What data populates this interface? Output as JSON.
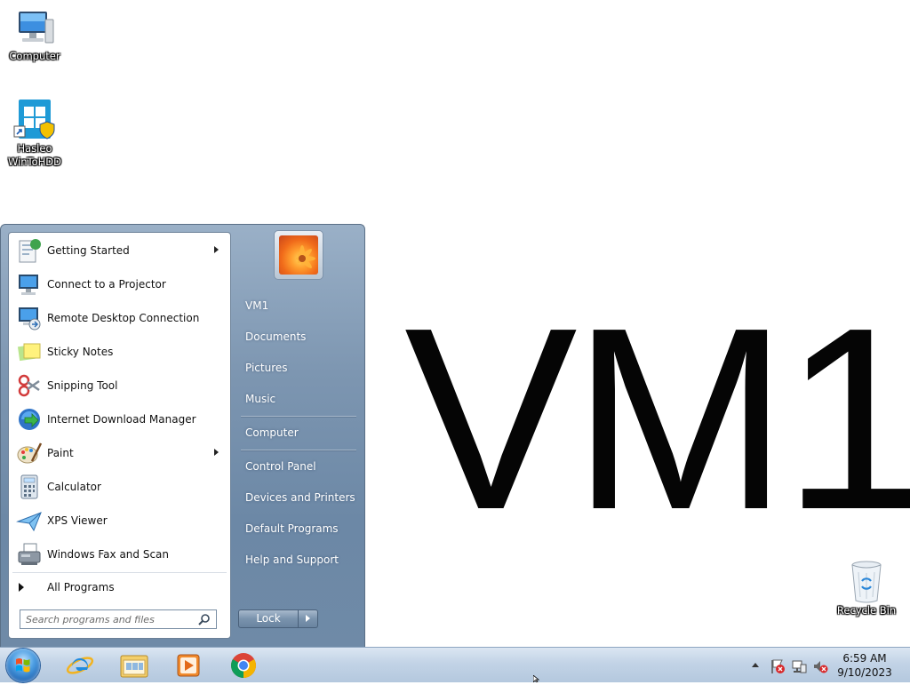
{
  "desktop": {
    "wallpaper_text": "VM1",
    "icons": [
      {
        "label": "Computer"
      },
      {
        "label": "Hasleo WinToHDD"
      },
      {
        "label": "Recycle Bin"
      }
    ]
  },
  "start_menu": {
    "programs": [
      {
        "label": "Getting Started",
        "icon": "getting-started-icon",
        "submenu": true
      },
      {
        "label": "Connect to a Projector",
        "icon": "projector-icon",
        "submenu": false
      },
      {
        "label": "Remote Desktop Connection",
        "icon": "remote-desktop-icon",
        "submenu": false
      },
      {
        "label": "Sticky Notes",
        "icon": "sticky-notes-icon",
        "submenu": false
      },
      {
        "label": "Snipping Tool",
        "icon": "snipping-tool-icon",
        "submenu": false
      },
      {
        "label": "Internet Download Manager",
        "icon": "idm-icon",
        "submenu": false
      },
      {
        "label": "Paint",
        "icon": "paint-icon",
        "submenu": true
      },
      {
        "label": "Calculator",
        "icon": "calculator-icon",
        "submenu": false
      },
      {
        "label": "XPS Viewer",
        "icon": "xps-viewer-icon",
        "submenu": false
      },
      {
        "label": "Windows Fax and Scan",
        "icon": "fax-scan-icon",
        "submenu": false
      }
    ],
    "all_programs": "All Programs",
    "search_placeholder": "Search programs and files",
    "right_items": [
      {
        "label": "VM1"
      },
      {
        "label": "Documents"
      },
      {
        "label": "Pictures"
      },
      {
        "label": "Music"
      },
      {
        "label": "Computer"
      },
      {
        "label": "Control Panel"
      },
      {
        "label": "Devices and Printers"
      },
      {
        "label": "Default Programs"
      },
      {
        "label": "Help and Support"
      }
    ],
    "lock_label": "Lock"
  },
  "taskbar": {
    "pinned": [
      "internet-explorer-icon",
      "windows-explorer-icon",
      "media-player-icon",
      "chrome-icon"
    ],
    "clock_time": "6:59 AM",
    "clock_date": "9/10/2023"
  }
}
